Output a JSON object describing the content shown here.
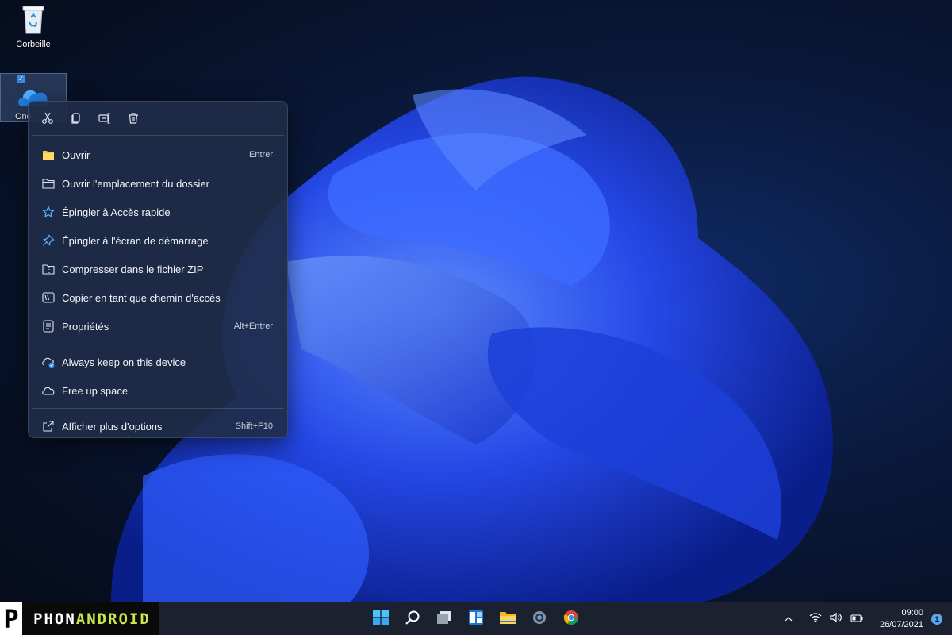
{
  "desktop": {
    "icons": [
      {
        "label": "Corbeille"
      },
      {
        "label": "One"
      }
    ]
  },
  "context_menu": {
    "toolbar": [
      {
        "icon": "scissors-icon",
        "tooltip": "Couper"
      },
      {
        "icon": "copy-icon",
        "tooltip": "Copier"
      },
      {
        "icon": "rename-icon",
        "tooltip": "Renommer"
      },
      {
        "icon": "trash-icon",
        "tooltip": "Supprimer"
      }
    ],
    "items": [
      {
        "label": "Ouvrir",
        "shortcut": "Entrer",
        "icon": "folder-icon"
      },
      {
        "label": "Ouvrir l'emplacement du dossier",
        "shortcut": "",
        "icon": "folder-outline-icon"
      },
      {
        "label": "Épingler à Accès rapide",
        "shortcut": "",
        "icon": "star-icon"
      },
      {
        "label": "Épingler à l'écran de démarrage",
        "shortcut": "",
        "icon": "pin-icon"
      },
      {
        "label": "Compresser dans le fichier ZIP",
        "shortcut": "",
        "icon": "zip-icon"
      },
      {
        "label": "Copier en tant que chemin d'accès",
        "shortcut": "",
        "icon": "path-icon"
      },
      {
        "label": "Propriétés",
        "shortcut": "Alt+Entrer",
        "icon": "properties-icon"
      }
    ],
    "cloud_items": [
      {
        "label": "Always keep on this device",
        "icon": "cloud-sync-icon"
      },
      {
        "label": "Free up space",
        "icon": "cloud-icon"
      }
    ],
    "more": {
      "label": "Afficher plus d'options",
      "shortcut": "Shift+F10",
      "icon": "open-external-icon"
    }
  },
  "taskbar": {
    "brand": {
      "part1": "PHON",
      "part2": "ANDROID"
    },
    "apps": [
      {
        "icon": "start-icon"
      },
      {
        "icon": "search-icon"
      },
      {
        "icon": "task-view-icon"
      },
      {
        "icon": "widgets-icon"
      },
      {
        "icon": "file-explorer-icon"
      },
      {
        "icon": "settings-icon"
      },
      {
        "icon": "chrome-icon"
      }
    ],
    "tray": {
      "time": "09:00",
      "date": "26/07/2021",
      "notification_count": "1"
    }
  },
  "colors": {
    "accent": "#3a8ee6",
    "menu_bg": "#1e2c48",
    "taskbar_bg": "#1c2230"
  }
}
